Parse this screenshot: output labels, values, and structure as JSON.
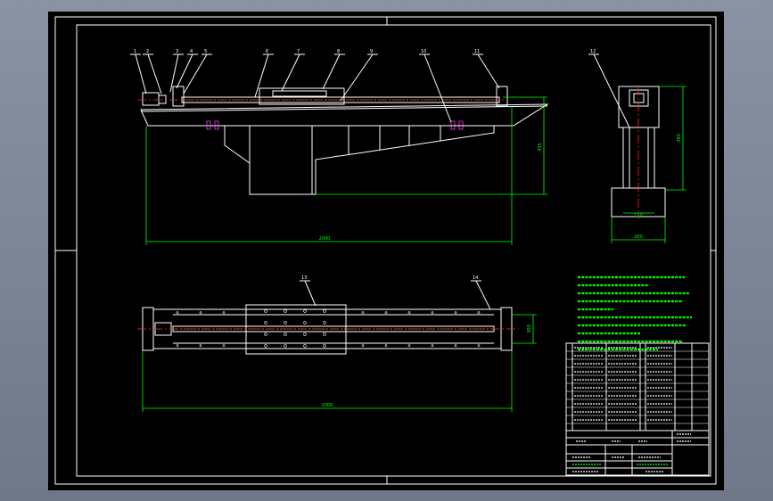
{
  "drawing": {
    "part_numbers": [
      "1",
      "2",
      "3",
      "4",
      "5",
      "6",
      "7",
      "8",
      "9",
      "10",
      "11",
      "12",
      "13",
      "14"
    ],
    "dimensions": {
      "front_length": "2000",
      "front_height": "455",
      "side_width": "120",
      "side_base_width": "200",
      "side_height": "380",
      "plan_length": "2000",
      "plan_width": "300"
    },
    "notes_lines": 7,
    "bom_rows": 11
  },
  "colors": {
    "background": "#000000",
    "outline": "#ffffff",
    "dimension": "#00ff00",
    "centerline": "#ff2a2a",
    "hatch": "#ffff00",
    "bolt": "#ff33ff",
    "window": "#7b8494"
  }
}
